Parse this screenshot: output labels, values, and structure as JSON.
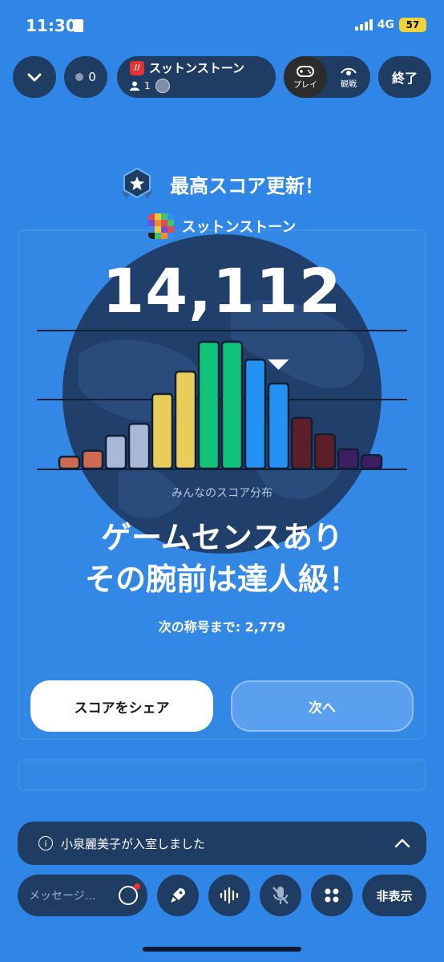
{
  "status": {
    "time": "11:30",
    "network": "4G",
    "battery": "57"
  },
  "top": {
    "viewer_count": "0",
    "game_title": "スットンストーン",
    "player_count": "1",
    "mode_play": "プレイ",
    "mode_watch": "観戦",
    "end_label": "終了"
  },
  "result": {
    "badge_title": "最高スコア更新！",
    "game_name": "スットンストーン",
    "score": "14,112",
    "distribution_label": "みんなのスコア分布",
    "headline_line1": "ゲームセンスあり",
    "headline_line2": "その腕前は達人級！",
    "next_title": "次の称号まで: 2,779"
  },
  "buttons": {
    "share": "スコアをシェア",
    "next": "次へ"
  },
  "notice": {
    "text": "小泉麗美子が入室しました"
  },
  "bottom": {
    "message_placeholder": "メッセージ…",
    "hide": "非表示"
  },
  "colors": {
    "background": "#2f86e6",
    "panel": "#1f3d63",
    "globe": "#203f6b"
  },
  "chart_data": {
    "type": "bar",
    "values": [
      8,
      12,
      22,
      30,
      50,
      65,
      85,
      85,
      73,
      57,
      34,
      23,
      13,
      9
    ],
    "colors": [
      "#cd6a4f",
      "#cd6a4f",
      "#a7b8d8",
      "#a7b8d8",
      "#e9cd5a",
      "#e9cd5a",
      "#10c27a",
      "#10c27a",
      "#2392f2",
      "#2392f2",
      "#5c1f28",
      "#5c1f28",
      "#3c1f63",
      "#3c1f63"
    ],
    "marker_index": 9
  }
}
